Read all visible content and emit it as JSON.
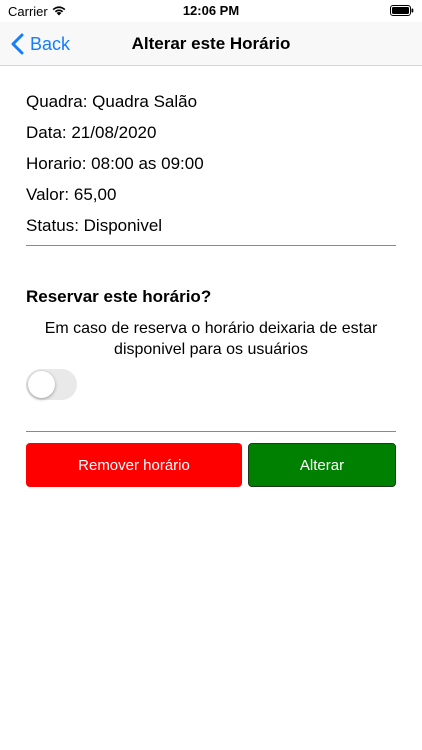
{
  "status_bar": {
    "carrier": "Carrier",
    "time": "12:06 PM"
  },
  "nav": {
    "back_label": "Back",
    "title": "Alterar este Horário"
  },
  "info": {
    "quadra": "Quadra: Quadra Salão",
    "data": "Data: 21/08/2020",
    "horario": "Horario: 08:00 as 09:00",
    "valor": "Valor: 65,00",
    "status": "Status: Disponivel"
  },
  "reserve": {
    "heading": "Reservar este horário?",
    "note": "Em caso de reserva o horário deixaria de estar disponivel para os usuários",
    "toggle_on": false
  },
  "buttons": {
    "remove_label": "Remover horário",
    "alter_label": "Alterar"
  },
  "colors": {
    "accent": "#147efb",
    "remove": "#ff0000",
    "alter": "#008000"
  }
}
